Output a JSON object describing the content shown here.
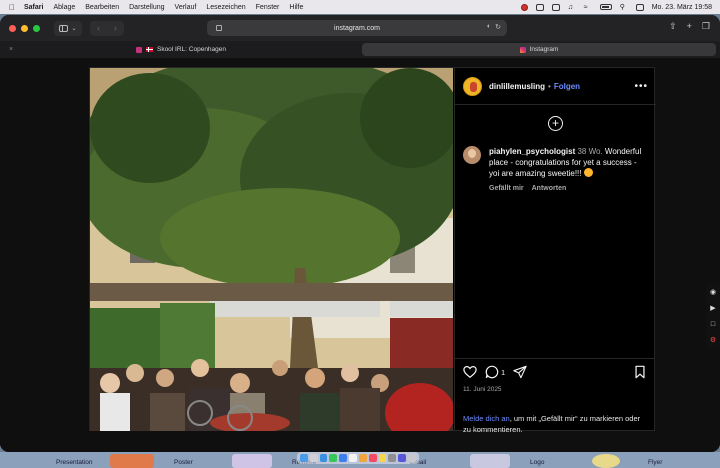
{
  "menubar": {
    "app": "Safari",
    "items": [
      "Ablage",
      "Bearbeiten",
      "Darstellung",
      "Verlauf",
      "Lesezeichen",
      "Fenster",
      "Hilfe"
    ],
    "clock": "Mo. 23. März 19:58"
  },
  "browser": {
    "address": "instagram.com",
    "tabs": [
      {
        "label": "Skool IRL: Copenhagen",
        "active": false
      },
      {
        "label": "Instagram",
        "active": true
      }
    ]
  },
  "post": {
    "owner": "dinlillemusling",
    "follow_label": "Folgen",
    "separator": "•",
    "more": "•••",
    "comment": {
      "user": "piahylen_psychologist",
      "time": "38 Wo.",
      "text": "Wonderful place - congratulations for yet a success - yoi are amazing sweetie!!!",
      "like_label": "Gefällt mir",
      "reply_label": "Antworten"
    },
    "comment_count": "1",
    "date": "11. Juni 2025",
    "login_link": "Melde dich an",
    "login_text": ", um mit „Gefällt mir“ zu markieren oder zu kommentieren."
  },
  "dock": {
    "labels": [
      "Presentation",
      "Poster",
      "Resume",
      "Email",
      "Logo",
      "Flyer"
    ]
  },
  "colors": {
    "link": "#6b8cff",
    "panel_bg": "#000000",
    "window_bg": "#0f0f10"
  }
}
